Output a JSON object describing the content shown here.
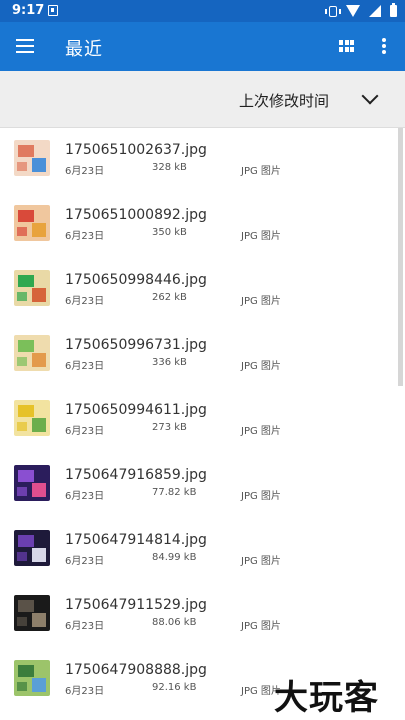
{
  "status": {
    "time": "9:17"
  },
  "appbar": {
    "title": "最近"
  },
  "sort": {
    "label": "上次修改时间"
  },
  "files": [
    {
      "name": "1750651002637.jpg",
      "date": "6月23日",
      "size": "328 kB",
      "type": "JPG 图片",
      "colors": [
        "#f3d9c6",
        "#e07a5f",
        "#4a90d9"
      ]
    },
    {
      "name": "1750651000892.jpg",
      "date": "6月23日",
      "size": "350 kB",
      "type": "JPG 图片",
      "colors": [
        "#f0c79e",
        "#d94a3a",
        "#e8a33d"
      ]
    },
    {
      "name": "1750650998446.jpg",
      "date": "6月23日",
      "size": "262 kB",
      "type": "JPG 图片",
      "colors": [
        "#e9d9a6",
        "#2fa84f",
        "#d6643a"
      ]
    },
    {
      "name": "1750650996731.jpg",
      "date": "6月23日",
      "size": "336 kB",
      "type": "JPG 图片",
      "colors": [
        "#efdcae",
        "#7bbf5a",
        "#e39a4c"
      ]
    },
    {
      "name": "1750650994611.jpg",
      "date": "6月23日",
      "size": "273 kB",
      "type": "JPG 图片",
      "colors": [
        "#f2e3a0",
        "#e6c229",
        "#6cae4c"
      ]
    },
    {
      "name": "1750647916859.jpg",
      "date": "6月23日",
      "size": "77.82 kB",
      "type": "JPG 图片",
      "colors": [
        "#2b1d5c",
        "#8a4fd1",
        "#e04f8f"
      ]
    },
    {
      "name": "1750647914814.jpg",
      "date": "6月23日",
      "size": "84.99 kB",
      "type": "JPG 图片",
      "colors": [
        "#1e1a3a",
        "#6a3fb0",
        "#d7d7e8"
      ]
    },
    {
      "name": "1750647911529.jpg",
      "date": "6月23日",
      "size": "88.06 kB",
      "type": "JPG 图片",
      "colors": [
        "#1a1a1a",
        "#5a5248",
        "#8d7f6a"
      ]
    },
    {
      "name": "1750647908888.jpg",
      "date": "6月23日",
      "size": "92.16 kB",
      "type": "JPG 图片",
      "colors": [
        "#9cc46a",
        "#3c7d3c",
        "#5a9fd6"
      ]
    }
  ],
  "watermark": "大玩客"
}
